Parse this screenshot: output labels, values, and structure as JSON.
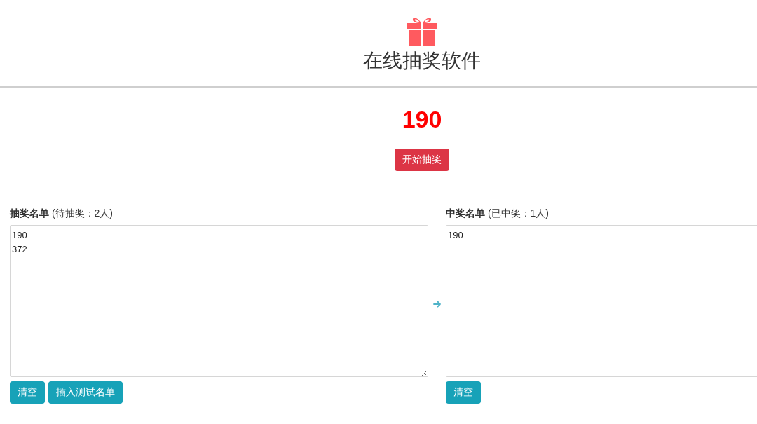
{
  "header": {
    "title": "在线抽奖软件"
  },
  "draw": {
    "current": "190",
    "button": "开始抽奖"
  },
  "pool": {
    "label": "**抽奖名单** (待抽奖：2人)",
    "entries": [
      "190",
      "372"
    ],
    "buttons": [
      "清空",
      "插入测试名单"
    ]
  },
  "winners": {
    "label": "**中奖名单** (已中奖：1人)",
    "entries": [
      "190"
    ],
    "buttons": [
      "清空"
    ]
  }
}
